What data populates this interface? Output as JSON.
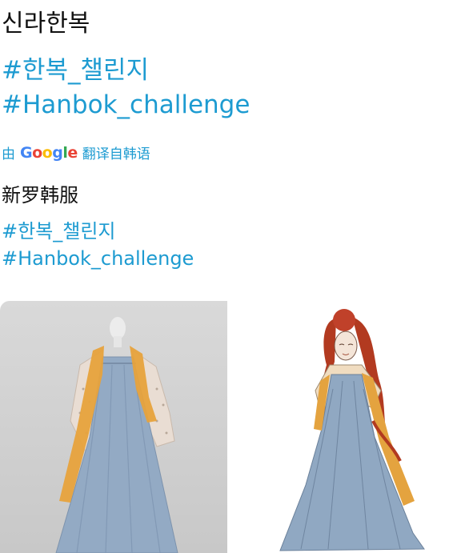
{
  "post": {
    "title": "신라한복",
    "hashtag_1": "#한복_챌린지",
    "hashtag_2": "#Hanbok_challenge"
  },
  "translation": {
    "prefix": "由",
    "provider": "Google",
    "suffix": "翻译自韩语",
    "title": "新罗韩服",
    "hashtag_1": "#한복_챌린지",
    "hashtag_2": "#Hanbok_challenge"
  },
  "colors": {
    "link": "#1d9bd1",
    "text": "#111111"
  }
}
